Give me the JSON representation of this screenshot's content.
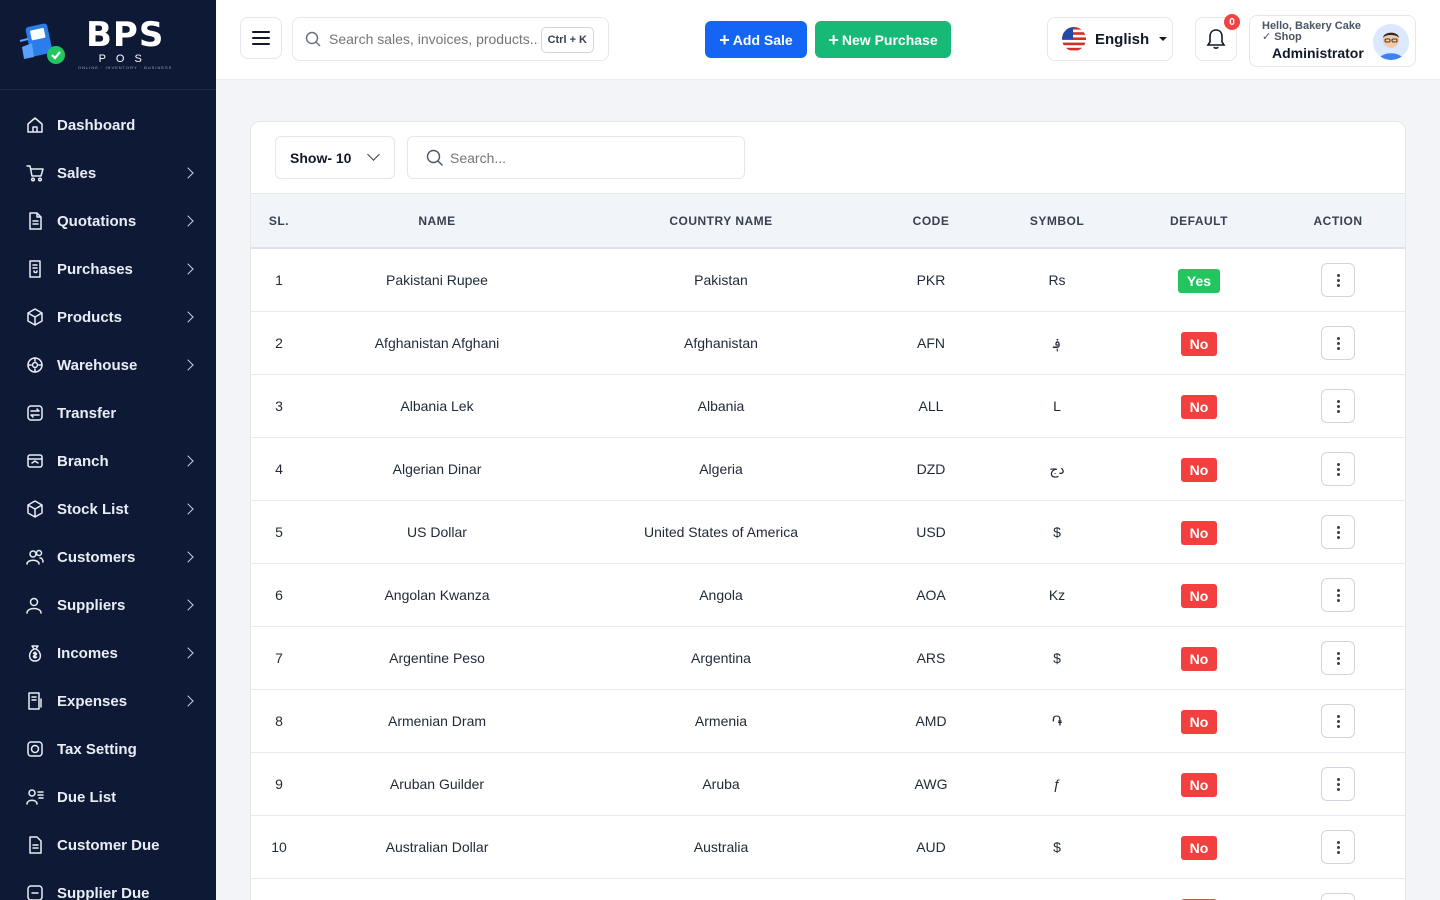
{
  "brand": {
    "name": "BPS",
    "sub": "POS",
    "tag": "ONLINE · INVENTORY · BUSINESS"
  },
  "sidebar": {
    "items": [
      {
        "label": "Dashboard",
        "icon": "home-icon",
        "has_children": false
      },
      {
        "label": "Sales",
        "icon": "cart-icon",
        "has_children": true
      },
      {
        "label": "Quotations",
        "icon": "document-icon",
        "has_children": true
      },
      {
        "label": "Purchases",
        "icon": "receipt-icon",
        "has_children": true
      },
      {
        "label": "Products",
        "icon": "box-icon",
        "has_children": true
      },
      {
        "label": "Warehouse",
        "icon": "warehouse-icon",
        "has_children": true
      },
      {
        "label": "Transfer",
        "icon": "transfer-icon",
        "has_children": false
      },
      {
        "label": "Branch",
        "icon": "branch-icon",
        "has_children": true
      },
      {
        "label": "Stock List",
        "icon": "stock-icon",
        "has_children": true
      },
      {
        "label": "Customers",
        "icon": "users-icon",
        "has_children": true
      },
      {
        "label": "Suppliers",
        "icon": "supplier-icon",
        "has_children": true
      },
      {
        "label": "Incomes",
        "icon": "money-bag-icon",
        "has_children": true
      },
      {
        "label": "Expenses",
        "icon": "expense-icon",
        "has_children": true
      },
      {
        "label": "Tax Setting",
        "icon": "tax-icon",
        "has_children": false
      },
      {
        "label": "Due List",
        "icon": "due-list-icon",
        "has_children": false
      },
      {
        "label": "Customer Due",
        "icon": "customer-due-icon",
        "has_children": false
      },
      {
        "label": "Supplier Due",
        "icon": "supplier-due-icon",
        "has_children": false
      }
    ]
  },
  "header": {
    "search_placeholder": "Search sales, invoices, products...",
    "shortcut": "Ctrl + K",
    "add_sale": "Add Sale",
    "new_purchase": "New Purchase",
    "language": "English",
    "notifications": "0",
    "greeting": "Hello, Bakery Cake ✓ Shop",
    "role": "Administrator"
  },
  "table": {
    "show_label": "Show- 10",
    "search_placeholder": "Search...",
    "columns": [
      "SL.",
      "NAME",
      "COUNTRY NAME",
      "CODE",
      "SYMBOL",
      "DEFAULT",
      "ACTION"
    ],
    "rows": [
      {
        "sl": "1",
        "name": "Pakistani Rupee",
        "country": "Pakistan",
        "code": "PKR",
        "symbol": "Rs",
        "default": "Yes"
      },
      {
        "sl": "2",
        "name": "Afghanistan Afghani",
        "country": "Afghanistan",
        "code": "AFN",
        "symbol": "؋",
        "default": "No"
      },
      {
        "sl": "3",
        "name": "Albania Lek",
        "country": "Albania",
        "code": "ALL",
        "symbol": "L",
        "default": "No"
      },
      {
        "sl": "4",
        "name": "Algerian Dinar",
        "country": "Algeria",
        "code": "DZD",
        "symbol": "دج",
        "default": "No"
      },
      {
        "sl": "5",
        "name": "US Dollar",
        "country": "United States of America",
        "code": "USD",
        "symbol": "$",
        "default": "No"
      },
      {
        "sl": "6",
        "name": "Angolan Kwanza",
        "country": "Angola",
        "code": "AOA",
        "symbol": "Kz",
        "default": "No"
      },
      {
        "sl": "7",
        "name": "Argentine Peso",
        "country": "Argentina",
        "code": "ARS",
        "symbol": "$",
        "default": "No"
      },
      {
        "sl": "8",
        "name": "Armenian Dram",
        "country": "Armenia",
        "code": "AMD",
        "symbol": "֏",
        "default": "No"
      },
      {
        "sl": "9",
        "name": "Aruban Guilder",
        "country": "Aruba",
        "code": "AWG",
        "symbol": "ƒ",
        "default": "No"
      },
      {
        "sl": "10",
        "name": "Australian Dollar",
        "country": "Australia",
        "code": "AUD",
        "symbol": "$",
        "default": "No"
      },
      {
        "sl": "",
        "name": "",
        "country": "",
        "code": "",
        "symbol": "",
        "default": "No"
      }
    ]
  },
  "colors": {
    "sidebar_bg": "#0e1a35",
    "primary": "#1565f4",
    "success": "#16b975",
    "yes": "#22c55e",
    "no": "#f43f3f"
  }
}
